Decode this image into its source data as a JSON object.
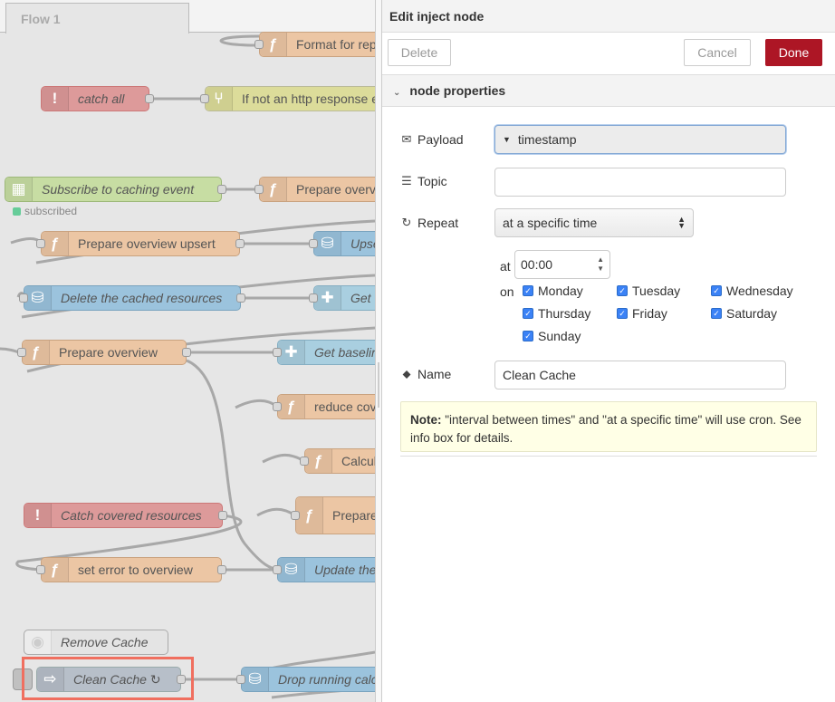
{
  "workspace": {
    "tab_label": "Flow 1",
    "nodes": [
      {
        "label": "Format for rep",
        "icon": "function-icon"
      },
      {
        "label": "catch all",
        "icon": "exclamation-icon"
      },
      {
        "label": "If not an http response e",
        "icon": "switch-icon"
      },
      {
        "label": "Subscribe to caching event",
        "icon": "calendar-icon"
      },
      {
        "label": "Prepare overvi",
        "icon": "function-icon"
      },
      {
        "label": "Prepare overview upsert",
        "icon": "function-icon"
      },
      {
        "label": "Upse",
        "icon": "database-icon"
      },
      {
        "label": "Delete the cached resources",
        "icon": "database-icon"
      },
      {
        "label": "Get t",
        "icon": "puzzle-icon"
      },
      {
        "label": "Prepare overview",
        "icon": "function-icon"
      },
      {
        "label": "Get baselin",
        "icon": "puzzle-icon"
      },
      {
        "label": "reduce cov",
        "icon": "function-icon"
      },
      {
        "label": "Calcul",
        "icon": "function-icon"
      },
      {
        "label": "Catch covered resources",
        "icon": "exclamation-icon"
      },
      {
        "label": "Prepare",
        "icon": "function-icon"
      },
      {
        "label": "set error to overview",
        "icon": "function-icon"
      },
      {
        "label": "Update the",
        "icon": "database-icon"
      },
      {
        "label": "Remove Cache",
        "icon": "comment-icon"
      },
      {
        "label": "Clean Cache",
        "icon": "inject-arrow-icon",
        "badge": "↻"
      },
      {
        "label": "Drop running calc",
        "icon": "database-icon"
      }
    ],
    "status_subscribed": "subscribed"
  },
  "panel": {
    "title": "Edit inject node",
    "delete_label": "Delete",
    "cancel_label": "Cancel",
    "done_label": "Done",
    "section_label": "node properties",
    "payload": {
      "label": "Payload",
      "value": "timestamp"
    },
    "topic": {
      "label": "Topic",
      "value": ""
    },
    "repeat": {
      "label": "Repeat",
      "value": "at a specific time"
    },
    "at_label": "at",
    "time_value": "00:00",
    "on_label": "on",
    "days": [
      {
        "name": "Monday",
        "checked": true
      },
      {
        "name": "Tuesday",
        "checked": true
      },
      {
        "name": "Wednesday",
        "checked": true
      },
      {
        "name": "Thursday",
        "checked": true
      },
      {
        "name": "Friday",
        "checked": true
      },
      {
        "name": "Saturday",
        "checked": true
      },
      {
        "name": "Sunday",
        "checked": true
      }
    ],
    "name": {
      "label": "Name",
      "value": "Clean Cache"
    },
    "note_bold": "Note:",
    "note_text": " \"interval between times\" and \"at a specific time\" will use cron. See info box for details."
  },
  "colors": {
    "done_button": "#ad1625",
    "highlight_box": "#f06f5f",
    "checkbox": "#3b82f6",
    "note_bg": "#ffffe6"
  }
}
